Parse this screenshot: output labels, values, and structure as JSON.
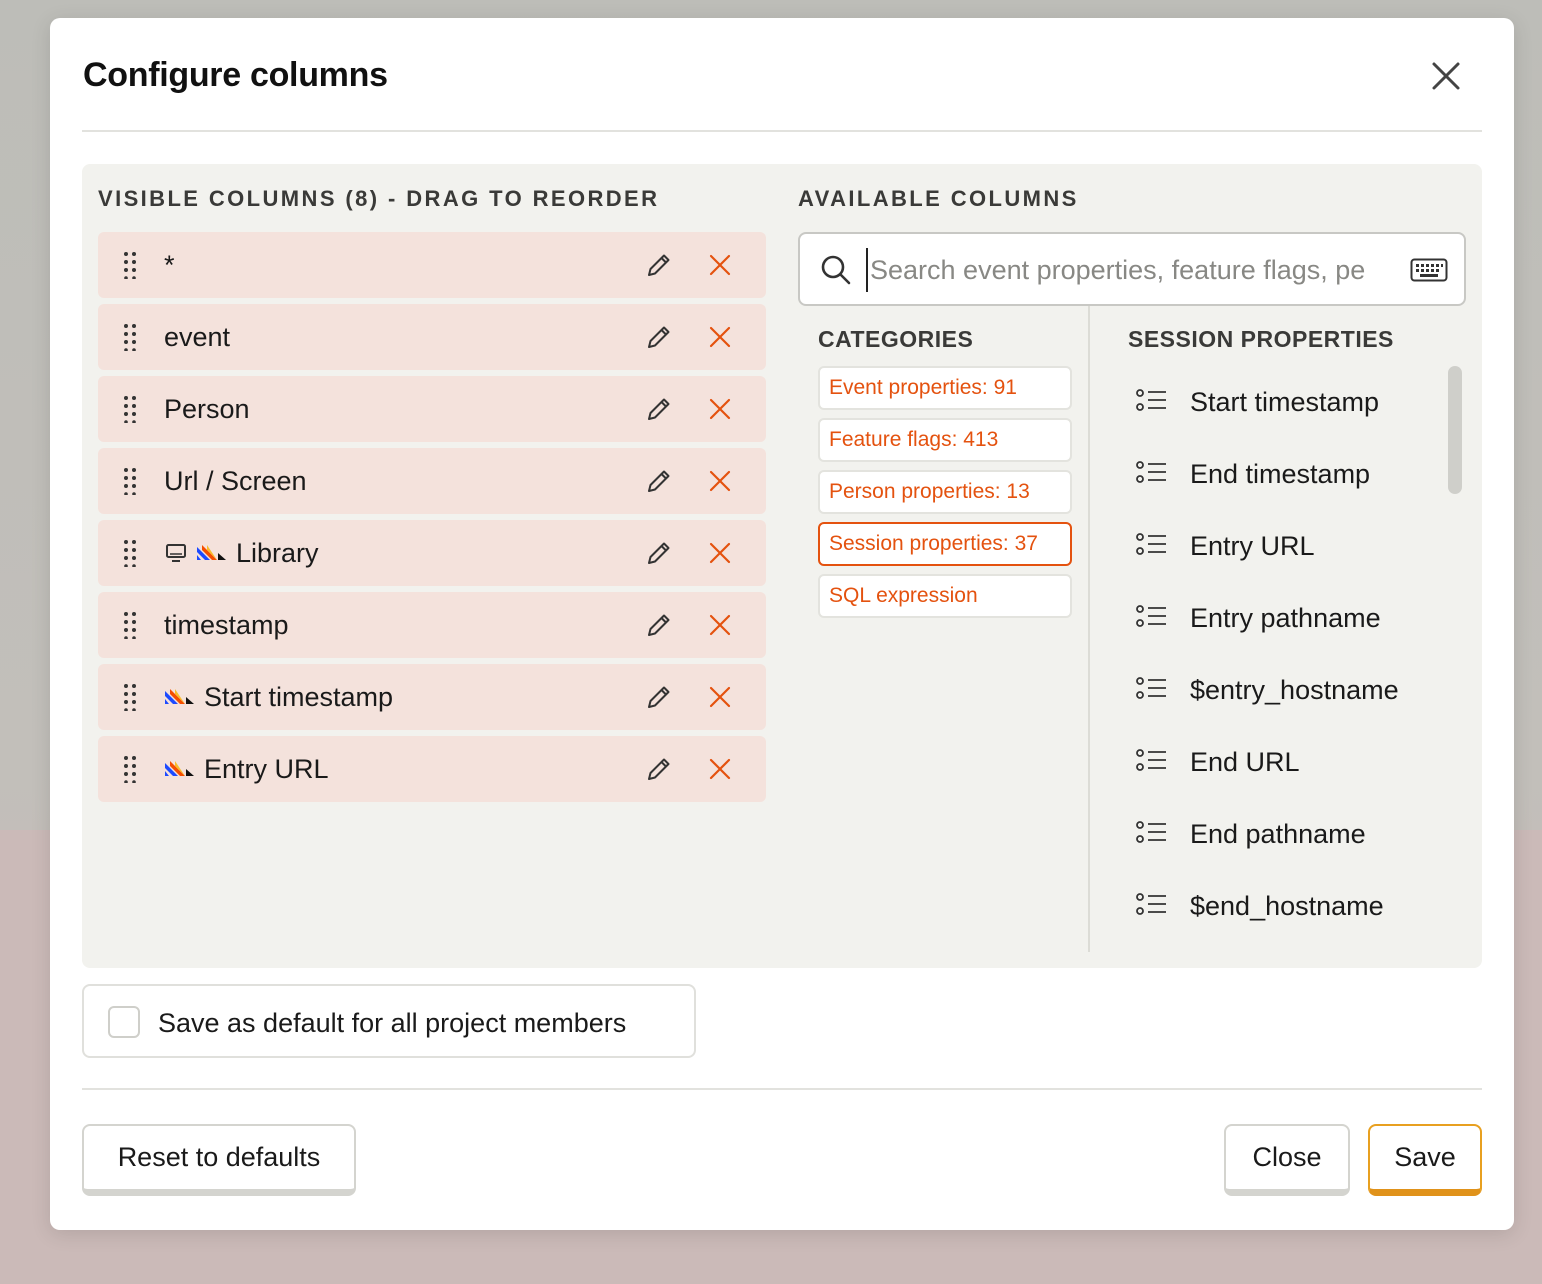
{
  "dialog": {
    "title": "Configure columns"
  },
  "visible_columns": {
    "header": "VISIBLE COLUMNS (8) - DRAG TO REORDER",
    "items": [
      {
        "label": "*",
        "icons": []
      },
      {
        "label": "event",
        "icons": []
      },
      {
        "label": "Person",
        "icons": []
      },
      {
        "label": "Url / Screen",
        "icons": []
      },
      {
        "label": "Library",
        "icons": [
          "monitor-icon",
          "posthog-logo-icon"
        ]
      },
      {
        "label": "timestamp",
        "icons": []
      },
      {
        "label": "Start timestamp",
        "icons": [
          "posthog-logo-icon"
        ]
      },
      {
        "label": "Entry URL",
        "icons": [
          "posthog-logo-icon"
        ]
      }
    ]
  },
  "available_columns": {
    "header": "AVAILABLE COLUMNS",
    "search": {
      "placeholder": "Search event properties, feature flags, pe",
      "value": ""
    },
    "categories": {
      "header": "CATEGORIES",
      "items": [
        {
          "label": "Event properties: 91",
          "active": false
        },
        {
          "label": "Feature flags: 413",
          "active": false
        },
        {
          "label": "Person properties: 13",
          "active": false
        },
        {
          "label": "Session properties: 37",
          "active": true
        },
        {
          "label": "SQL expression",
          "active": false
        }
      ]
    },
    "properties": {
      "header": "SESSION PROPERTIES",
      "items": [
        "Start timestamp",
        "End timestamp",
        "Entry URL",
        "Entry pathname",
        "$entry_hostname",
        "End URL",
        "End pathname",
        "$end_hostname"
      ]
    }
  },
  "save_default": {
    "label": "Save as default for all project members",
    "checked": false
  },
  "footer": {
    "reset_label": "Reset to defaults",
    "close_label": "Close",
    "save_label": "Save"
  },
  "colors": {
    "accent": "#e4520f",
    "row_bg": "#f4e2dc",
    "panel_bg": "#f2f2ee",
    "primary_border": "#e8a020"
  }
}
